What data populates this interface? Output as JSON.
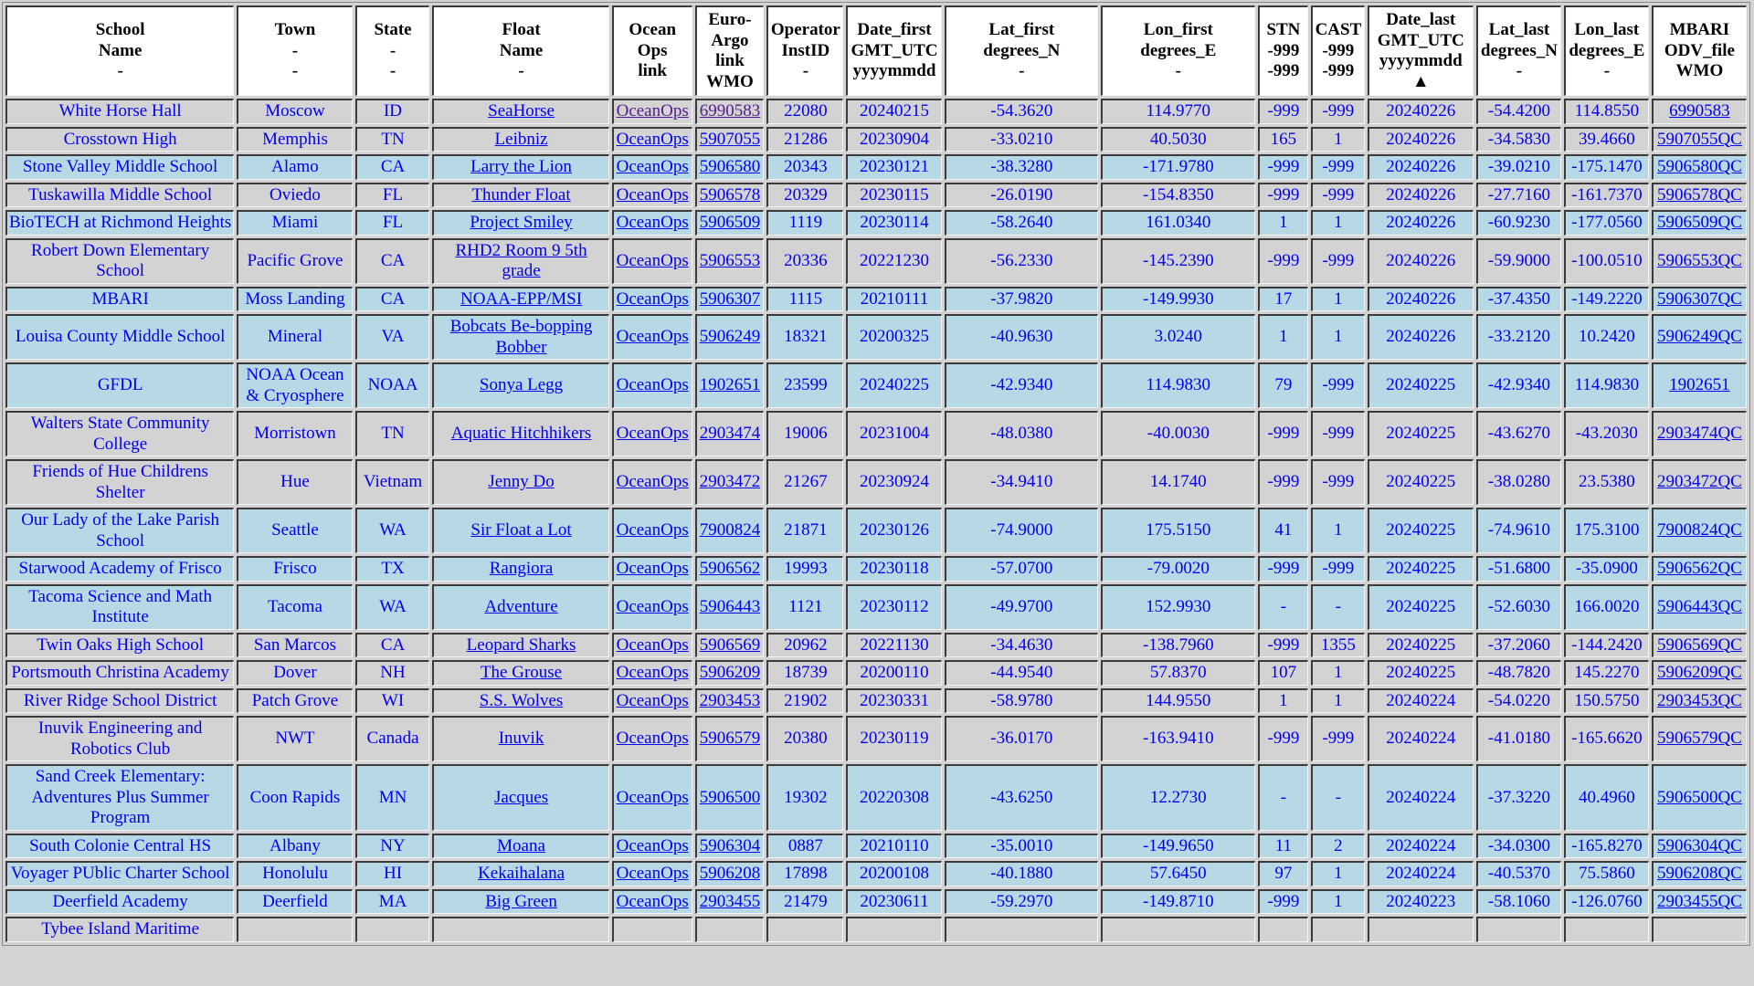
{
  "colors": {
    "page_bg": "#d3d3d3",
    "header_bg": "#ffffff",
    "row_gray": "#d3d3d3",
    "row_blue": "#b7d9e5",
    "link": "#0000ee",
    "visited_link": "#551a8b"
  },
  "table": {
    "headers": [
      {
        "key": "school",
        "lines": [
          "School",
          "Name",
          "-"
        ]
      },
      {
        "key": "town",
        "lines": [
          "Town",
          "-",
          "-"
        ]
      },
      {
        "key": "state",
        "lines": [
          "State",
          "-",
          "-"
        ]
      },
      {
        "key": "float",
        "lines": [
          "Float",
          "Name",
          "-"
        ]
      },
      {
        "key": "oceanops",
        "lines": [
          "Ocean",
          "Ops",
          "link"
        ]
      },
      {
        "key": "euroargo",
        "lines": [
          "Euro-",
          "Argo",
          "link",
          "WMO"
        ]
      },
      {
        "key": "operator",
        "lines": [
          "Operator",
          "InstID",
          "-"
        ]
      },
      {
        "key": "date_first",
        "lines": [
          "Date_first",
          "GMT_UTC",
          "yyyymmdd"
        ]
      },
      {
        "key": "lat_first",
        "lines": [
          "Lat_first",
          "degrees_N",
          "-"
        ]
      },
      {
        "key": "lon_first",
        "lines": [
          "Lon_first",
          "degrees_E",
          "-"
        ]
      },
      {
        "key": "stn",
        "lines": [
          "STN",
          "-999",
          "-999"
        ]
      },
      {
        "key": "cast",
        "lines": [
          "CAST",
          "-999",
          "-999"
        ]
      },
      {
        "key": "date_last",
        "lines": [
          "Date_last",
          "GMT_UTC",
          "yyyymmdd ▲"
        ],
        "sorted": "ascending-indicator"
      },
      {
        "key": "lat_last",
        "lines": [
          "Lat_last",
          "degrees_N",
          "-"
        ]
      },
      {
        "key": "lon_last",
        "lines": [
          "Lon_last",
          "degrees_E",
          "-"
        ]
      },
      {
        "key": "odv",
        "lines": [
          "MBARI",
          "ODV_file",
          "WMO"
        ]
      }
    ],
    "rows": [
      {
        "shade": "gray",
        "school": "White Horse Hall",
        "town": "Moscow",
        "state": "ID",
        "float": "SeaHorse",
        "oceanops": "OceanOps",
        "oceanops_visited": true,
        "wmo": "6990583",
        "wmo_visited": true,
        "operator": "22080",
        "date_first": "20240215",
        "lat_first": "-54.3620",
        "lon_first": "114.9770",
        "stn": "-999",
        "cast": "-999",
        "date_last": "20240226",
        "lat_last": "-54.4200",
        "lon_last": "114.8550",
        "odv": "6990583"
      },
      {
        "shade": "gray",
        "school": "Crosstown High",
        "town": "Memphis",
        "state": "TN",
        "float": "Leibniz",
        "oceanops": "OceanOps",
        "wmo": "5907055",
        "operator": "21286",
        "date_first": "20230904",
        "lat_first": "-33.0210",
        "lon_first": "40.5030",
        "stn": "165",
        "cast": "1",
        "date_last": "20240226",
        "lat_last": "-34.5830",
        "lon_last": "39.4660",
        "odv": "5907055QC"
      },
      {
        "shade": "blue",
        "school": "Stone Valley Middle School",
        "town": "Alamo",
        "state": "CA",
        "float": "Larry the Lion",
        "oceanops": "OceanOps",
        "wmo": "5906580",
        "operator": "20343",
        "date_first": "20230121",
        "lat_first": "-38.3280",
        "lon_first": "-171.9780",
        "stn": "-999",
        "cast": "-999",
        "date_last": "20240226",
        "lat_last": "-39.0210",
        "lon_last": "-175.1470",
        "odv": "5906580QC"
      },
      {
        "shade": "gray",
        "school": "Tuskawilla Middle School",
        "town": "Oviedo",
        "state": "FL",
        "float": "Thunder Float",
        "oceanops": "OceanOps",
        "wmo": "5906578",
        "operator": "20329",
        "date_first": "20230115",
        "lat_first": "-26.0190",
        "lon_first": "-154.8350",
        "stn": "-999",
        "cast": "-999",
        "date_last": "20240226",
        "lat_last": "-27.7160",
        "lon_last": "-161.7370",
        "odv": "5906578QC"
      },
      {
        "shade": "blue",
        "school": "BioTECH at Richmond Heights",
        "town": "Miami",
        "state": "FL",
        "float": "Project Smiley",
        "oceanops": "OceanOps",
        "wmo": "5906509",
        "operator": "1119",
        "date_first": "20230114",
        "lat_first": "-58.2640",
        "lon_first": "161.0340",
        "stn": "1",
        "cast": "1",
        "date_last": "20240226",
        "lat_last": "-60.9230",
        "lon_last": "-177.0560",
        "odv": "5906509QC"
      },
      {
        "shade": "gray",
        "school": "Robert Down Elementary School",
        "town": "Pacific Grove",
        "state": "CA",
        "float": "RHD2 Room 9 5th grade",
        "oceanops": "OceanOps",
        "wmo": "5906553",
        "operator": "20336",
        "date_first": "20221230",
        "lat_first": "-56.2330",
        "lon_first": "-145.2390",
        "stn": "-999",
        "cast": "-999",
        "date_last": "20240226",
        "lat_last": "-59.9000",
        "lon_last": "-100.0510",
        "odv": "5906553QC"
      },
      {
        "shade": "blue",
        "school": "MBARI",
        "town": "Moss Landing",
        "state": "CA",
        "float": "NOAA-EPP/MSI",
        "oceanops": "OceanOps",
        "wmo": "5906307",
        "operator": "1115",
        "date_first": "20210111",
        "lat_first": "-37.9820",
        "lon_first": "-149.9930",
        "stn": "17",
        "cast": "1",
        "date_last": "20240226",
        "lat_last": "-37.4350",
        "lon_last": "-149.2220",
        "odv": "5906307QC"
      },
      {
        "shade": "blue",
        "school": "Louisa County Middle School",
        "town": "Mineral",
        "state": "VA",
        "float": "Bobcats Be-bopping Bobber",
        "oceanops": "OceanOps",
        "wmo": "5906249",
        "operator": "18321",
        "date_first": "20200325",
        "lat_first": "-40.9630",
        "lon_first": "3.0240",
        "stn": "1",
        "cast": "1",
        "date_last": "20240226",
        "lat_last": "-33.2120",
        "lon_last": "10.2420",
        "odv": "5906249QC"
      },
      {
        "shade": "blue",
        "school": "GFDL",
        "town": "NOAA Ocean & Cryosphere",
        "state": "NOAA",
        "float": "Sonya Legg",
        "oceanops": "OceanOps",
        "wmo": "1902651",
        "operator": "23599",
        "date_first": "20240225",
        "lat_first": "-42.9340",
        "lon_first": "114.9830",
        "stn": "79",
        "cast": "-999",
        "date_last": "20240225",
        "lat_last": "-42.9340",
        "lon_last": "114.9830",
        "odv": "1902651"
      },
      {
        "shade": "gray",
        "school": "Walters State Community College",
        "town": "Morristown",
        "state": "TN",
        "float": "Aquatic Hitchhikers",
        "oceanops": "OceanOps",
        "wmo": "2903474",
        "operator": "19006",
        "date_first": "20231004",
        "lat_first": "-48.0380",
        "lon_first": "-40.0030",
        "stn": "-999",
        "cast": "-999",
        "date_last": "20240225",
        "lat_last": "-43.6270",
        "lon_last": "-43.2030",
        "odv": "2903474QC"
      },
      {
        "shade": "gray",
        "school": "Friends of Hue Childrens Shelter",
        "town": "Hue",
        "state": "Vietnam",
        "float": "Jenny Do",
        "oceanops": "OceanOps",
        "wmo": "2903472",
        "operator": "21267",
        "date_first": "20230924",
        "lat_first": "-34.9410",
        "lon_first": "14.1740",
        "stn": "-999",
        "cast": "-999",
        "date_last": "20240225",
        "lat_last": "-38.0280",
        "lon_last": "23.5380",
        "odv": "2903472QC"
      },
      {
        "shade": "blue",
        "school": "Our Lady of the Lake Parish School",
        "town": "Seattle",
        "state": "WA",
        "float": "Sir Float a Lot",
        "oceanops": "OceanOps",
        "wmo": "7900824",
        "operator": "21871",
        "date_first": "20230126",
        "lat_first": "-74.9000",
        "lon_first": "175.5150",
        "stn": "41",
        "cast": "1",
        "date_last": "20240225",
        "lat_last": "-74.9610",
        "lon_last": "175.3100",
        "odv": "7900824QC"
      },
      {
        "shade": "blue",
        "school": "Starwood Academy of Frisco",
        "town": "Frisco",
        "state": "TX",
        "float": "Rangiora",
        "oceanops": "OceanOps",
        "wmo": "5906562",
        "operator": "19993",
        "date_first": "20230118",
        "lat_first": "-57.0700",
        "lon_first": "-79.0020",
        "stn": "-999",
        "cast": "-999",
        "date_last": "20240225",
        "lat_last": "-51.6800",
        "lon_last": "-35.0900",
        "odv": "5906562QC"
      },
      {
        "shade": "blue",
        "school": "Tacoma Science and Math Institute",
        "town": "Tacoma",
        "state": "WA",
        "float": "Adventure",
        "oceanops": "OceanOps",
        "wmo": "5906443",
        "operator": "1121",
        "date_first": "20230112",
        "lat_first": "-49.9700",
        "lon_first": "152.9930",
        "stn": "-",
        "cast": "-",
        "date_last": "20240225",
        "lat_last": "-52.6030",
        "lon_last": "166.0020",
        "odv": "5906443QC"
      },
      {
        "shade": "gray",
        "school": "Twin Oaks High School",
        "town": "San Marcos",
        "state": "CA",
        "float": "Leopard Sharks",
        "oceanops": "OceanOps",
        "wmo": "5906569",
        "operator": "20962",
        "date_first": "20221130",
        "lat_first": "-34.4630",
        "lon_first": "-138.7960",
        "stn": "-999",
        "cast": "1355",
        "date_last": "20240225",
        "lat_last": "-37.2060",
        "lon_last": "-144.2420",
        "odv": "5906569QC"
      },
      {
        "shade": "gray",
        "school": "Portsmouth Christina Academy",
        "town": "Dover",
        "state": "NH",
        "float": "The Grouse",
        "oceanops": "OceanOps",
        "wmo": "5906209",
        "operator": "18739",
        "date_first": "20200110",
        "lat_first": "-44.9540",
        "lon_first": "57.8370",
        "stn": "107",
        "cast": "1",
        "date_last": "20240225",
        "lat_last": "-48.7820",
        "lon_last": "145.2270",
        "odv": "5906209QC"
      },
      {
        "shade": "gray",
        "school": "River Ridge School District",
        "town": "Patch Grove",
        "state": "WI",
        "float": "S.S. Wolves",
        "oceanops": "OceanOps",
        "wmo": "2903453",
        "operator": "21902",
        "date_first": "20230331",
        "lat_first": "-58.9780",
        "lon_first": "144.9550",
        "stn": "1",
        "cast": "1",
        "date_last": "20240224",
        "lat_last": "-54.0220",
        "lon_last": "150.5750",
        "odv": "2903453QC"
      },
      {
        "shade": "gray",
        "school": "Inuvik Engineering and Robotics Club",
        "town": "NWT",
        "state": "Canada",
        "float": "Inuvik",
        "oceanops": "OceanOps",
        "wmo": "5906579",
        "operator": "20380",
        "date_first": "20230119",
        "lat_first": "-36.0170",
        "lon_first": "-163.9410",
        "stn": "-999",
        "cast": "-999",
        "date_last": "20240224",
        "lat_last": "-41.0180",
        "lon_last": "-165.6620",
        "odv": "5906579QC"
      },
      {
        "shade": "blue",
        "school": "Sand Creek Elementary: Adventures Plus Summer Program",
        "town": "Coon Rapids",
        "state": "MN",
        "float": "Jacques",
        "oceanops": "OceanOps",
        "wmo": "5906500",
        "operator": "19302",
        "date_first": "20220308",
        "lat_first": "-43.6250",
        "lon_first": "12.2730",
        "stn": "-",
        "cast": "-",
        "date_last": "20240224",
        "lat_last": "-37.3220",
        "lon_last": "40.4960",
        "odv": "5906500QC"
      },
      {
        "shade": "blue",
        "school": "South Colonie Central HS",
        "town": "Albany",
        "state": "NY",
        "float": "Moana",
        "oceanops": "OceanOps",
        "wmo": "5906304",
        "operator": "0887",
        "date_first": "20210110",
        "lat_first": "-35.0010",
        "lon_first": "-149.9650",
        "stn": "11",
        "cast": "2",
        "date_last": "20240224",
        "lat_last": "-34.0300",
        "lon_last": "-165.8270",
        "odv": "5906304QC"
      },
      {
        "shade": "blue",
        "school": "Voyager PUblic Charter School",
        "town": "Honolulu",
        "state": "HI",
        "float": "Kekaihalana",
        "oceanops": "OceanOps",
        "wmo": "5906208",
        "operator": "17898",
        "date_first": "20200108",
        "lat_first": "-40.1880",
        "lon_first": "57.6450",
        "stn": "97",
        "cast": "1",
        "date_last": "20240224",
        "lat_last": "-40.5370",
        "lon_last": "75.5860",
        "odv": "5906208QC"
      },
      {
        "shade": "blue",
        "school": "Deerfield Academy",
        "town": "Deerfield",
        "state": "MA",
        "float": "Big Green",
        "oceanops": "OceanOps",
        "wmo": "2903455",
        "operator": "21479",
        "date_first": "20230611",
        "lat_first": "-59.2970",
        "lon_first": "-149.8710",
        "stn": "-999",
        "cast": "1",
        "date_last": "20240223",
        "lat_last": "-58.1060",
        "lon_last": "-126.0760",
        "odv": "2903455QC"
      },
      {
        "shade": "gray",
        "partial": true,
        "school": "Tybee Island Maritime",
        "town": "",
        "state": "",
        "float": "",
        "oceanops": "",
        "wmo": "",
        "operator": "",
        "date_first": "",
        "lat_first": "",
        "lon_first": "",
        "stn": "",
        "cast": "",
        "date_last": "",
        "lat_last": "",
        "lon_last": "",
        "odv": ""
      }
    ]
  }
}
